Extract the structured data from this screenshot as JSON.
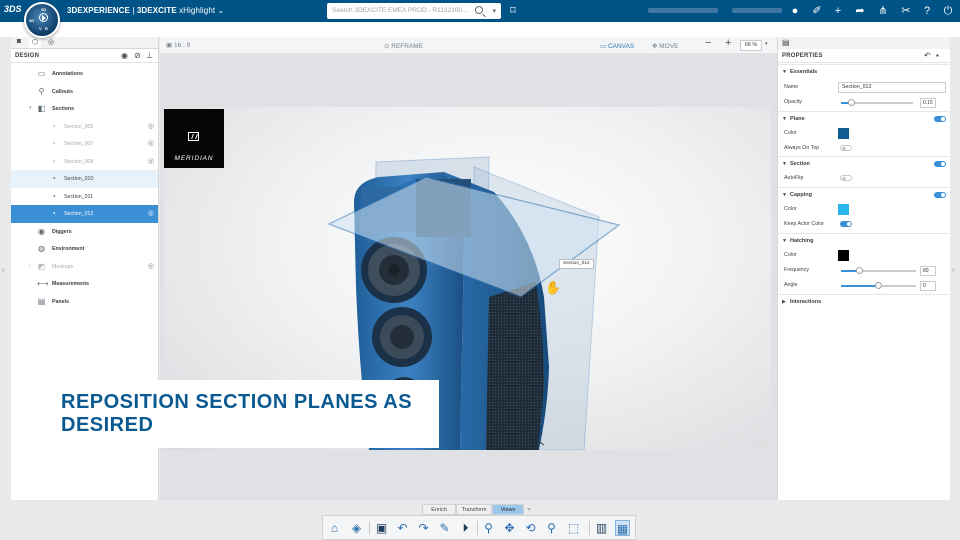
{
  "topbar": {
    "brand_bold": "3DEXPERIENCE",
    "brand_sep": " | ",
    "brand_app": "3DEXCITE",
    "brand_product": "xHighlight",
    "search_placeholder": "Search 3DEXCITE EMEA PROD - R1132100...",
    "compass": {
      "v": "V",
      "r": "R",
      "d": "3D"
    }
  },
  "left_panel": {
    "header": "DESIGN",
    "tree": [
      {
        "label": "Annotations",
        "style": "bold",
        "indent": 1
      },
      {
        "label": "Callouts",
        "style": "bold",
        "indent": 1
      },
      {
        "label": "Sections",
        "style": "bold",
        "indent": 1,
        "expanded": true
      },
      {
        "label": "Section_005",
        "style": "dim",
        "indent": 2
      },
      {
        "label": "Section_007",
        "style": "dim",
        "indent": 2
      },
      {
        "label": "Section_008",
        "style": "dim",
        "indent": 2
      },
      {
        "label": "Section_010",
        "style": "light",
        "indent": 2
      },
      {
        "label": "Section_011",
        "style": "normal",
        "indent": 2
      },
      {
        "label": "Section_012",
        "style": "selected",
        "indent": 2
      },
      {
        "label": "Diggers",
        "style": "bold",
        "indent": 1
      },
      {
        "label": "Environment",
        "style": "bold",
        "indent": 1
      },
      {
        "label": "Mockups",
        "style": "dim",
        "indent": 1
      },
      {
        "label": "Measurements",
        "style": "bold",
        "indent": 1
      },
      {
        "label": "Panels",
        "style": "bold",
        "indent": 1
      }
    ]
  },
  "viewer": {
    "aspect_ratio": "16 : 9",
    "reframe_label": "REFRAME",
    "canvas_label": "CANVAS",
    "move_label": "MOVE",
    "zoom_value": "68 %",
    "brand_logo_text": "MERIDIAN",
    "tooltip": "Section_012",
    "caption": "REPOSITION SECTION PLANES AS DESIRED"
  },
  "properties": {
    "header": "PROPERTIES",
    "essentials_label": "Essentials",
    "name_label": "Name",
    "name_value": "Section_012",
    "opacity_label": "Opacity",
    "opacity_value": "0.15",
    "opacity": 0.15,
    "plane_label": "Plane",
    "plane_color_label": "Color",
    "plane_color": "#0f5b92",
    "always_on_top_label": "Always On Top",
    "section_label": "Section",
    "autoflip_label": "AutoFlip",
    "capping_label": "Capping",
    "capping_color_label": "Color",
    "capping_color": "#29b6ef",
    "keep_actor_color_label": "Keep Actor Color",
    "hatching_label": "Hatching",
    "hatching_color_label": "Color",
    "hatching_color": "#000000",
    "frequency_label": "Frequency",
    "frequency_value": "80",
    "frequency": 0.25,
    "angle_label": "Angle",
    "angle_value": "0",
    "angle": 0.5,
    "interactions_label": "Interactions",
    "toggles": {
      "plane": true,
      "always_on_top": false,
      "section": true,
      "autoflip": false,
      "capping": true,
      "keep_actor_color": true
    }
  },
  "bottom": {
    "tabs": [
      "Enrich",
      "Transform",
      "Views"
    ],
    "active_tab": "Views"
  },
  "colors": {
    "accent": "#005386",
    "selection": "#3b8fd4",
    "caption": "#0a5a91"
  }
}
